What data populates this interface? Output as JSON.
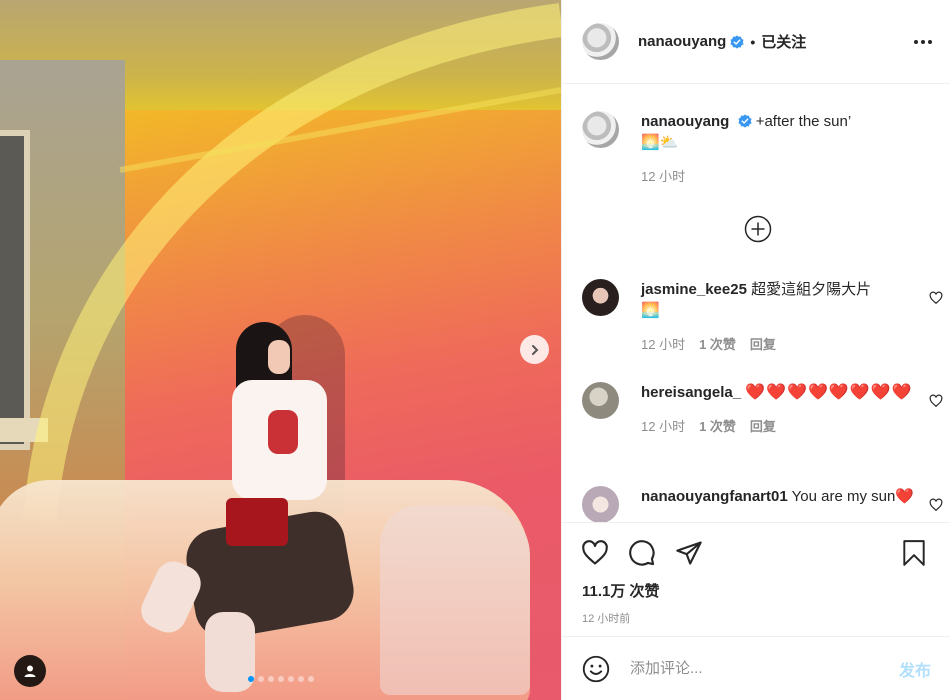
{
  "post": {
    "author": "nanaouyang",
    "follow_separator": "•",
    "follow_label": "已关注",
    "carousel": {
      "slide_count": 7,
      "active_index": 0
    }
  },
  "caption": {
    "username": "nanaouyang",
    "text": "+after the sun’",
    "emoji": "🌅⛅",
    "time": "12 小时"
  },
  "comments": [
    {
      "username": "jasmine_kee25",
      "text": "超愛這組夕陽大片",
      "emoji": "🌅",
      "time": "12 小时",
      "likes": "1 次赞",
      "reply": "回复"
    },
    {
      "username": "hereisangela_",
      "text": "❤️❤️❤️❤️❤️❤️❤️❤️",
      "time": "12 小时",
      "likes": "1 次赞",
      "reply": "回复"
    },
    {
      "username": "nanaouyangfanart01",
      "text": "You are my sun❤️"
    }
  ],
  "actions": {
    "likes_count": "11.1万 次赞",
    "timestamp": "12 小时前"
  },
  "add_comment": {
    "placeholder": "添加评论...",
    "post_label": "发布"
  },
  "colors": {
    "accent": "#0095f6",
    "post_disabled": "#b2dffc",
    "heart": "#ed1d3a",
    "secondary_text": "#8e8e8e"
  }
}
